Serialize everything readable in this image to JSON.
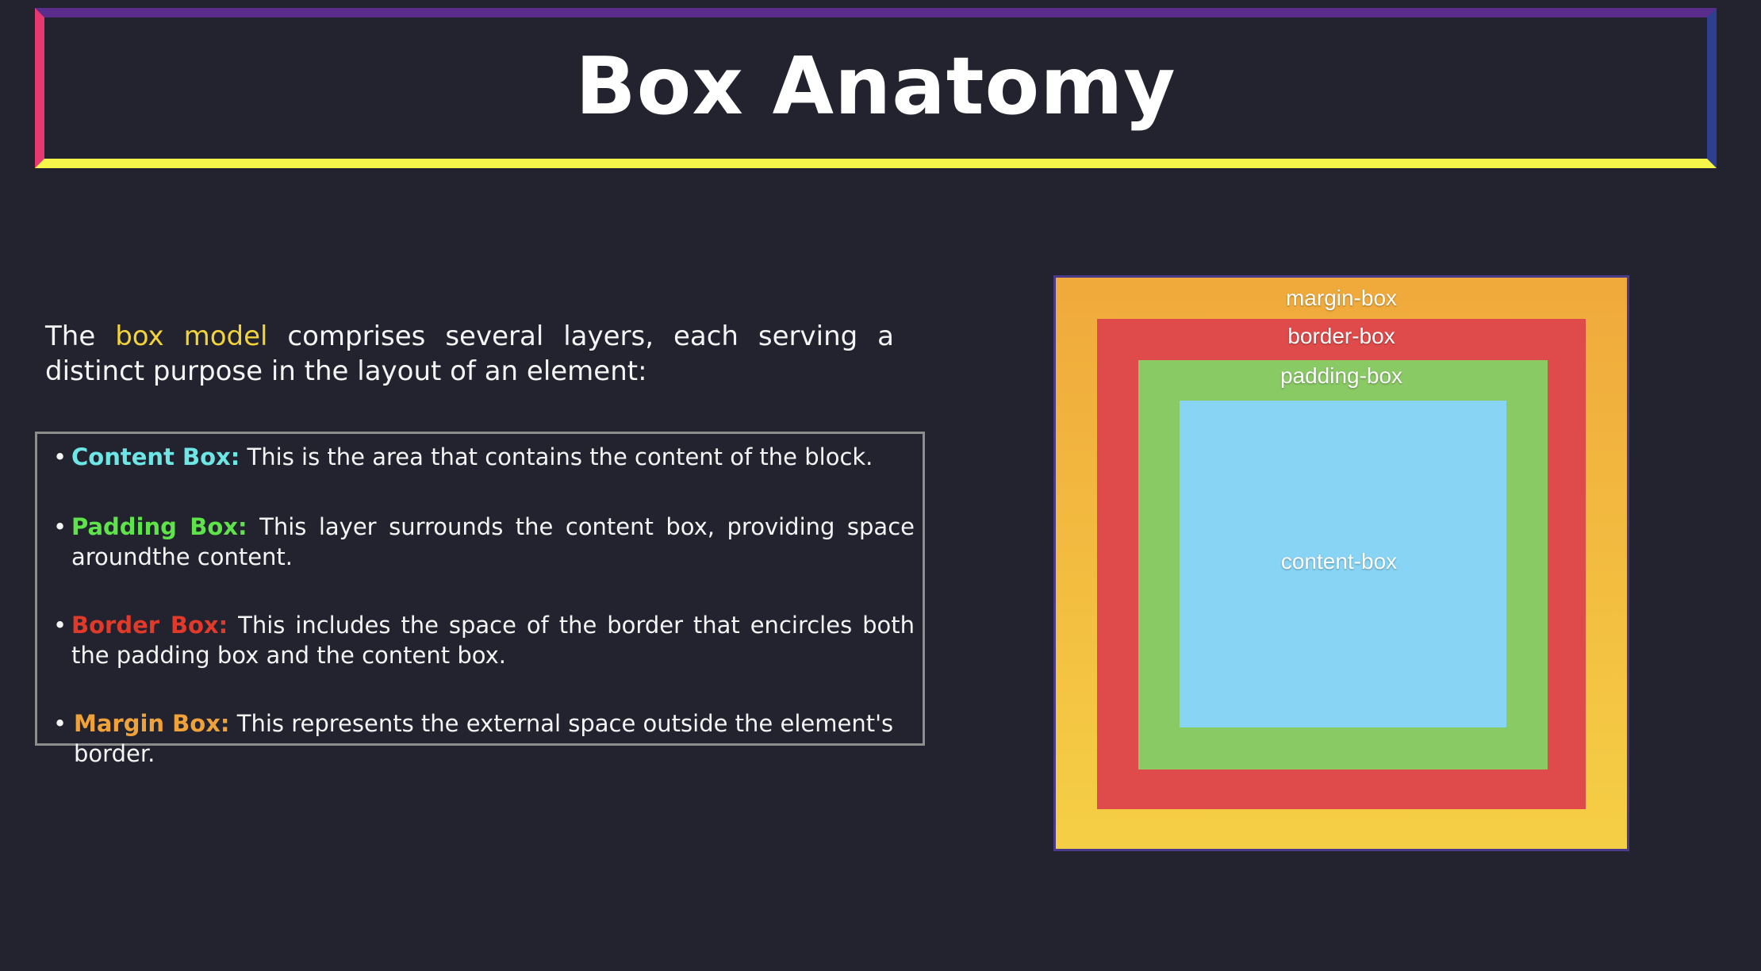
{
  "colors": {
    "background": "#22232e",
    "title_border_top": "#5a2d8c",
    "title_border_right": "#2f3f8f",
    "title_border_bottom": "#f5f54a",
    "title_border_left": "#e83870",
    "highlight": "#f3d33a",
    "content_term": "#6fe6e6",
    "padding_term": "#5ee34a",
    "border_term": "#e23a2a",
    "margin_term": "#f0a23a"
  },
  "header": {
    "title": "Box Anatomy"
  },
  "intro": {
    "before": "The ",
    "highlight": "box model",
    "after": " comprises several layers, each serving a distinct purpose in the layout of an element:"
  },
  "bullets": [
    {
      "dot": "•",
      "term": "Content Box:",
      "text": " This is the area that contains the content of the block."
    },
    {
      "dot": "•",
      "term": "Padding Box:",
      "text": " This layer surrounds the content box, providing space aroundthe content."
    },
    {
      "dot": "•",
      "term": "Border Box:",
      "text": " This includes the space of the border that encircles both the padding box and the content box."
    },
    {
      "dot": "•",
      "term": "Margin Box:",
      "text": " This represents the external space outside the element's border."
    }
  ],
  "diagram": {
    "margin_label": "margin-box",
    "border_label": "border-box",
    "padding_label": "padding-box",
    "content_label": "content-box"
  }
}
